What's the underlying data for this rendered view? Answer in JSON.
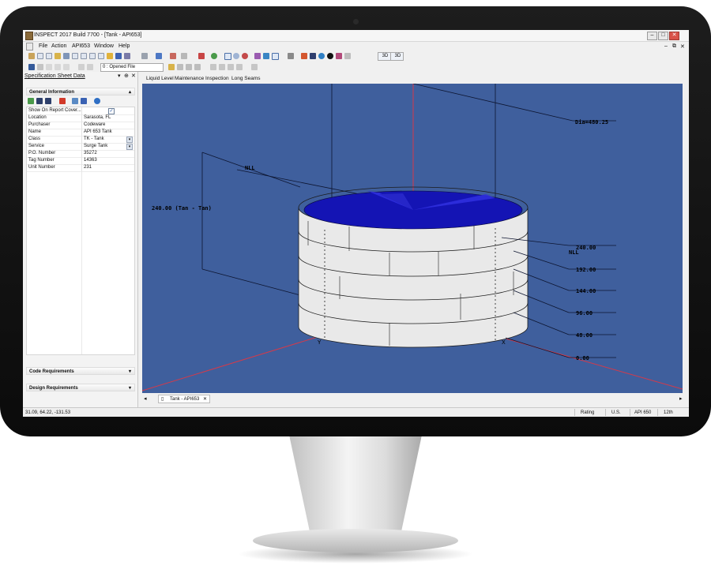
{
  "window": {
    "title": "INSPECT 2017 Build 7700 - [Tank - API653]"
  },
  "menu": [
    "File",
    "Action",
    "API653",
    "Window",
    "Help"
  ],
  "toolbar": {
    "file_combo": "0 : Opened File",
    "btn_3d": "3D",
    "btn_3d2": "3D"
  },
  "panel": {
    "title": "Specification Sheet Data",
    "group_general": "General Information",
    "group_code": "Code Requirements",
    "group_design": "Design Requirements",
    "rows": [
      {
        "label": "Show On Report Cover...",
        "value": ""
      },
      {
        "label": "Location",
        "value": "Sarasota, FL"
      },
      {
        "label": "Purchaser",
        "value": "Codeware"
      },
      {
        "label": "Name",
        "value": "API 653 Tank"
      },
      {
        "label": "Class",
        "value": "TK - Tank"
      },
      {
        "label": "Service",
        "value": "Surge Tank"
      },
      {
        "label": "P.O. Number",
        "value": "35272"
      },
      {
        "label": "Tag Number",
        "value": "14363"
      },
      {
        "label": "Unit Number",
        "value": "231"
      }
    ]
  },
  "view_tabs": [
    "Liquid Level",
    "Maintenance Inspection",
    "Long Seams"
  ],
  "model": {
    "dia": "Dia=480.25",
    "height": "240.00 (Tan - Tan)",
    "nll": "NLL",
    "levels": [
      "240.00",
      "192.00",
      "144.00",
      "96.00",
      "48.00",
      "0.00"
    ],
    "axis_y": "Y",
    "axis_x": "X",
    "colors": {
      "background": "#3f5f9d",
      "liquid": "#1414b4",
      "shell": "#ececec"
    }
  },
  "doc_tab": "Tank - API653",
  "status": {
    "coords": "31.09, 64.22, -131.53",
    "rating": "Rating",
    "units": "U.S.",
    "code": "API 650",
    "edition": "12th"
  }
}
